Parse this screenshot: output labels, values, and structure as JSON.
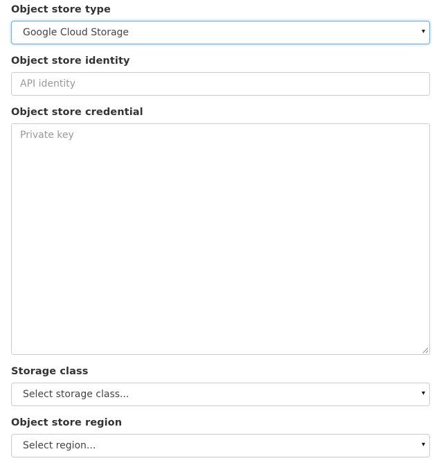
{
  "object_store_type": {
    "label": "Object store type",
    "selected": "Google Cloud Storage"
  },
  "object_store_identity": {
    "label": "Object store identity",
    "placeholder": "API identity"
  },
  "object_store_credential": {
    "label": "Object store credential",
    "placeholder": "Private key"
  },
  "storage_class": {
    "label": "Storage class",
    "selected": "Select storage class..."
  },
  "object_store_region": {
    "label": "Object store region",
    "selected": "Select region..."
  },
  "icons": {
    "caret": "▾",
    "caret_name": "caret-down-icon",
    "resize_name": "resize-handle-icon"
  },
  "colors": {
    "focus_border": "#66afe9",
    "border": "#cccccc",
    "placeholder": "#999999",
    "label": "#333333"
  }
}
